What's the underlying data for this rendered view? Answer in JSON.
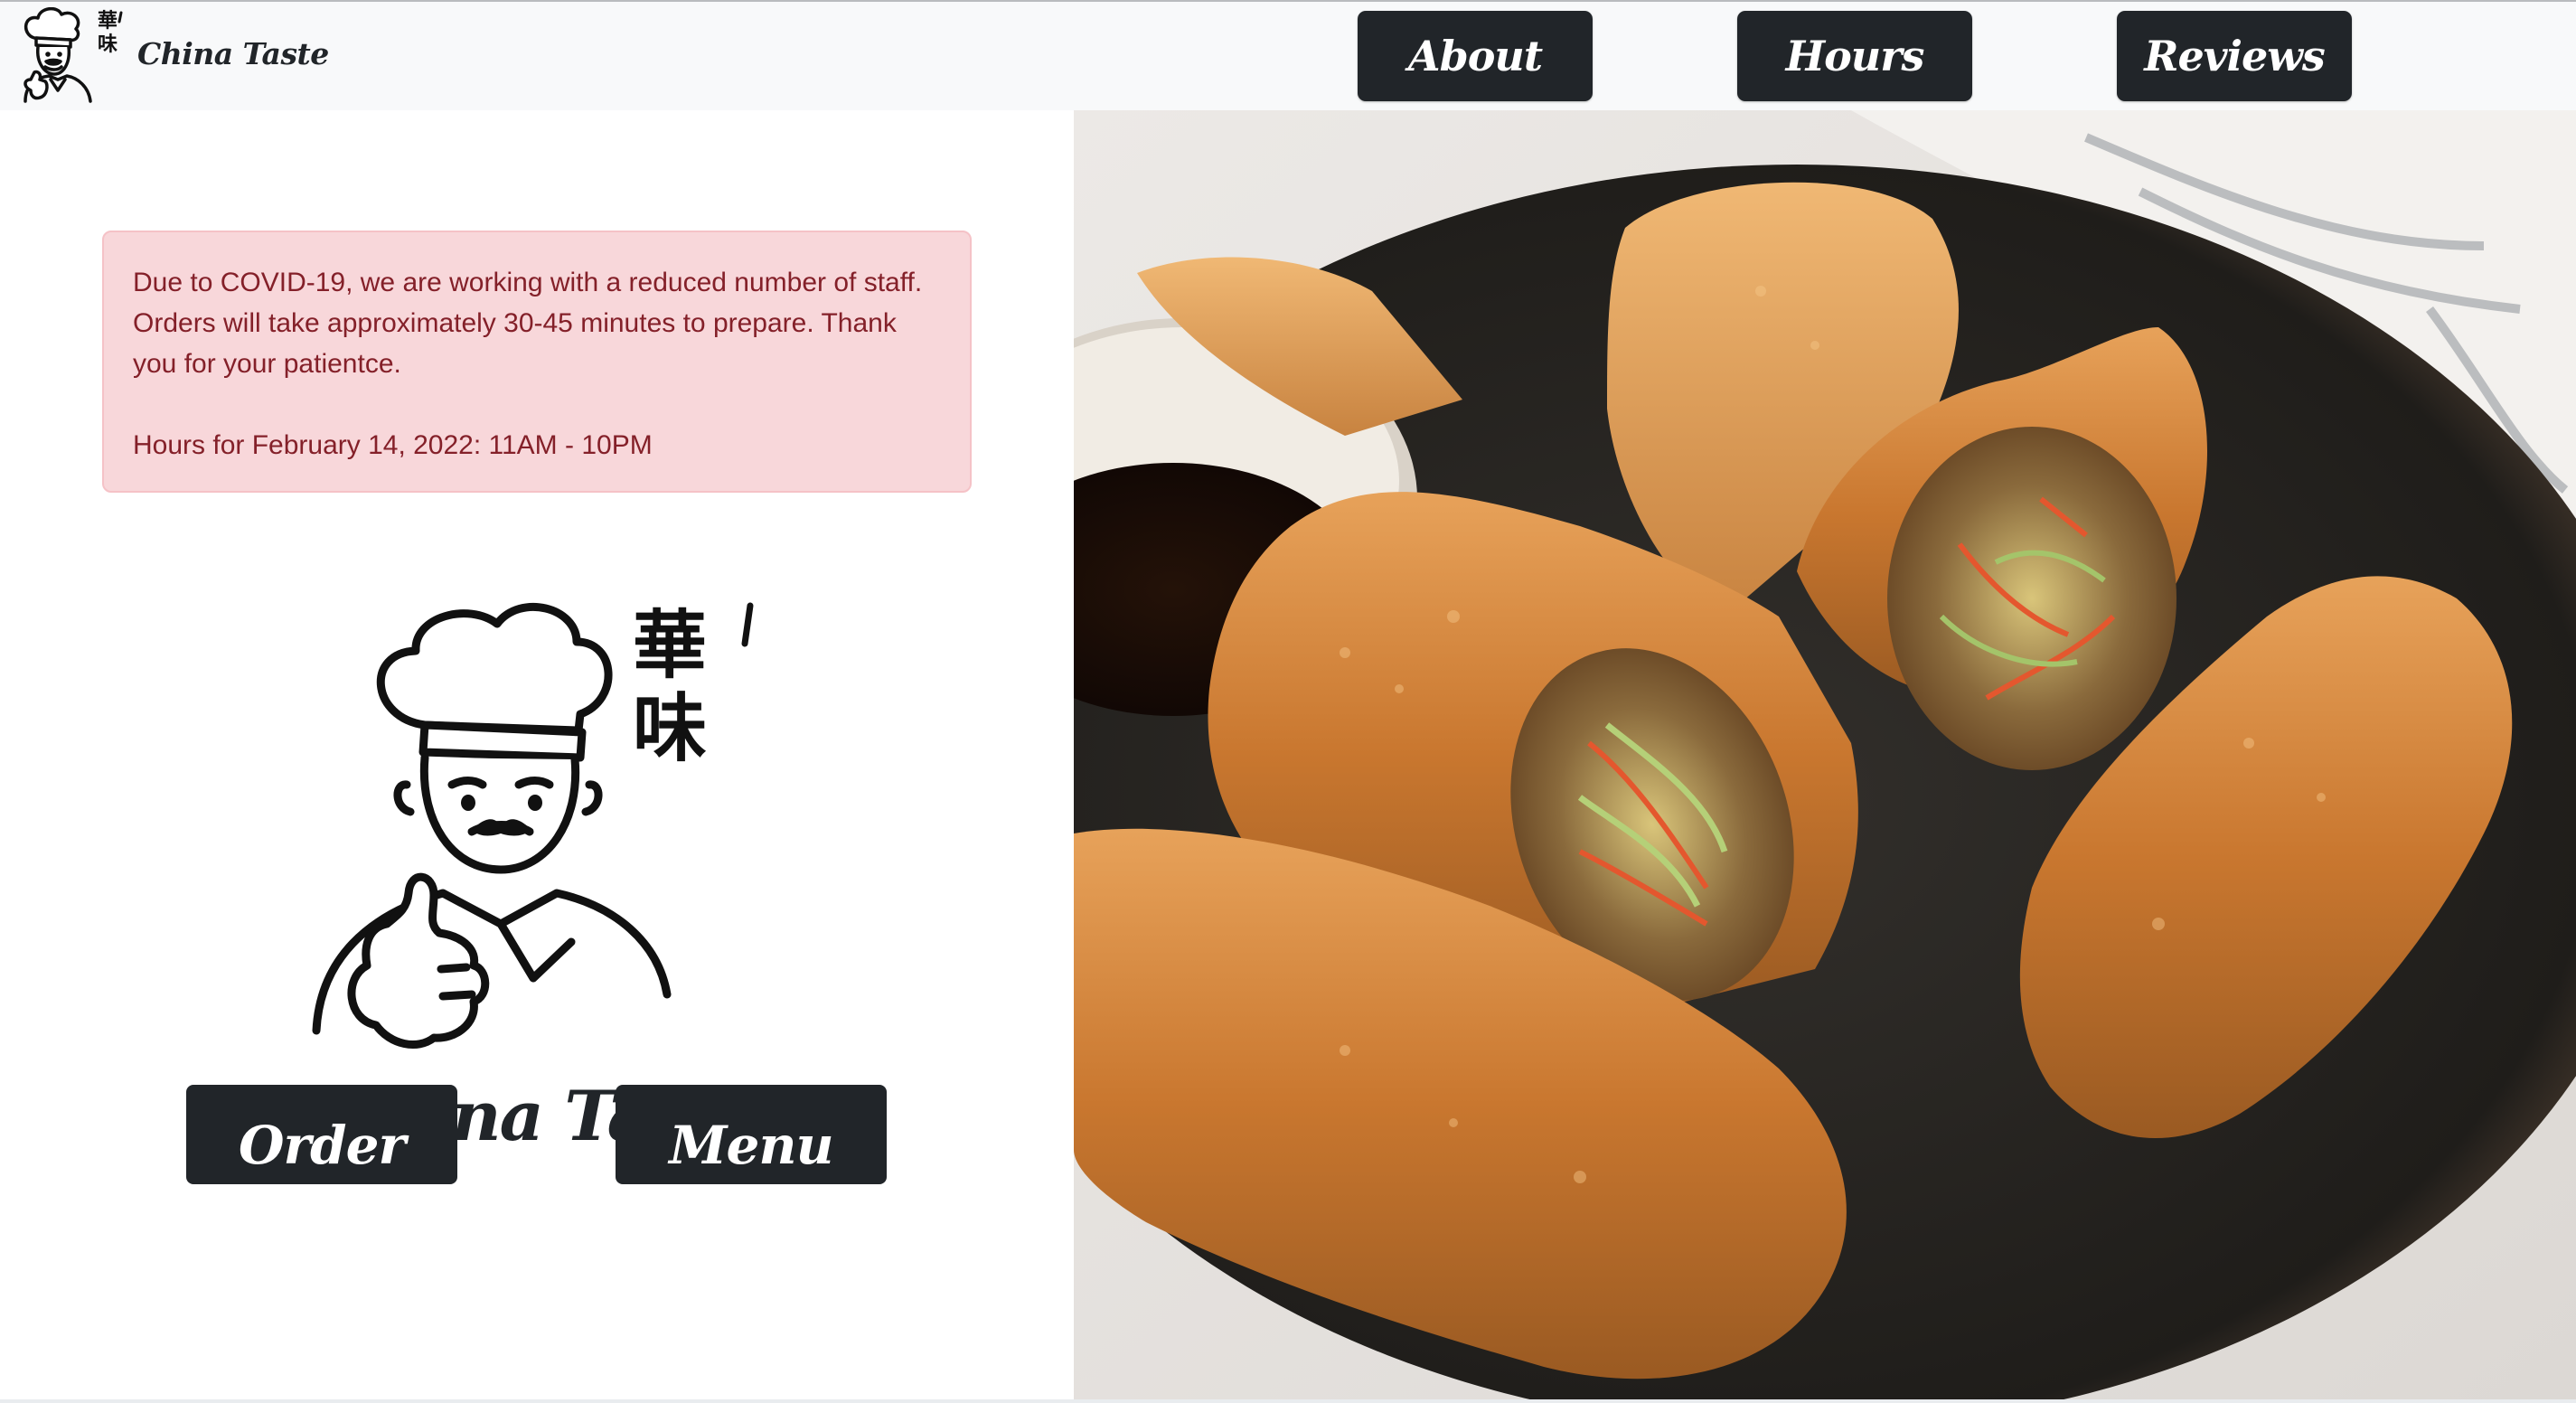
{
  "navbar": {
    "brand_name": "China Taste",
    "links": [
      {
        "label": "About"
      },
      {
        "label": "Hours"
      },
      {
        "label": "Reviews"
      }
    ]
  },
  "notice": {
    "covid_message": "Due to COVID-19, we are working with a reduced number of staff. Orders will take approximately 30-45 minutes to prepare. Thank you for your patientce.",
    "hours_message": "Hours for February 14, 2022: 11AM - 10PM"
  },
  "hero": {
    "logo_title": "China Taste",
    "logo_characters": "華味",
    "order_label": "Order",
    "menu_label": "Menu"
  },
  "colors": {
    "navbar_bg": "#f8f9fa",
    "button_bg": "#212529",
    "button_text": "#ffffff",
    "alert_bg": "#f8d7da",
    "alert_border": "#f5c2c7",
    "alert_text": "#842029"
  },
  "icons": {
    "brand_logo": "chef-thumbs-up-icon",
    "hero_logo": "chef-thumbs-up-icon",
    "hero_image": "egg-rolls-photo"
  }
}
